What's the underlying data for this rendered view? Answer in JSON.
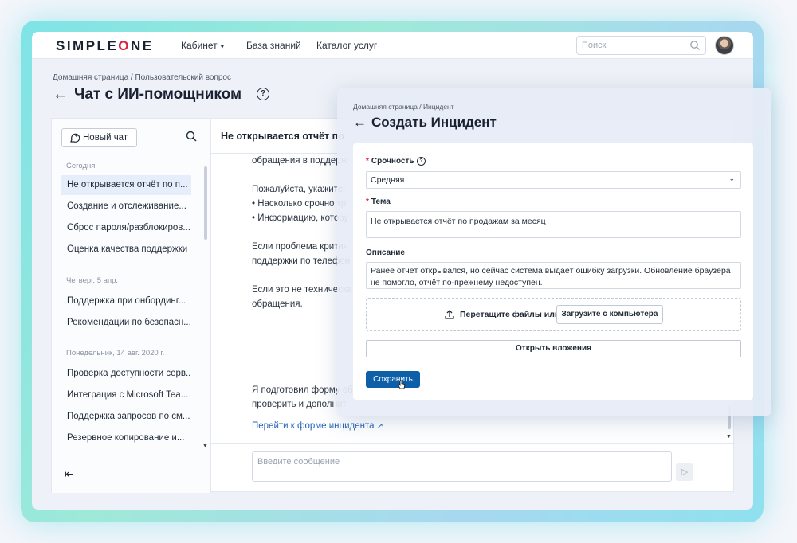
{
  "brand": {
    "logo_text": "SIMPLE",
    "logo_o": "O",
    "logo_end": "NE",
    "accent_color": "#d9233f"
  },
  "nav": {
    "items": [
      {
        "label": "Кабинет",
        "has_dropdown": true
      },
      {
        "label": "База знаний"
      },
      {
        "label": "Каталог услуг"
      }
    ],
    "search_placeholder": "Поиск"
  },
  "page": {
    "breadcrumb": "Домашняя страница  /  Пользовательский вопрос",
    "title": "Чат с ИИ-помощником"
  },
  "sidebar": {
    "new_chat_label": "Новый чат",
    "groups": [
      {
        "label": "Сегодня",
        "items": [
          "Не открывается отчёт по п...",
          "Создание и отслеживание...",
          "Сброс пароля/разблокиров...",
          "Оценка качества поддержки"
        ]
      },
      {
        "label": "Четверг, 5 апр.",
        "items": [
          "Поддержка при онбординг...",
          "Рекомендации по безопасн..."
        ]
      },
      {
        "label": "Понедельник, 14 авг. 2020 г.",
        "items": [
          "Проверка доступности серв...",
          "Интеграция с Microsoft Tea...",
          "Поддержка запросов по см...",
          "Резервное копирование и..."
        ]
      }
    ]
  },
  "chat": {
    "header_title": "Не открывается отчёт по",
    "messages": [
      "обращения в поддерж",
      "Пожалуйста, укажите:",
      "• Насколько срочно тр",
      "• Информацию, котору",
      "Если проблема критич",
      "поддержки по телефон",
      "Если это не техническа",
      "обращения.",
      "Я подготовил форму об",
      "проверить и дополнит"
    ],
    "link_text": "Перейти к форме инцидента",
    "composer_placeholder": "Введите сообщение"
  },
  "incident_form": {
    "breadcrumb": "Домашняя страница  /  Инцидент",
    "title": "Создать Инцидент",
    "urgency_label": "Срочность",
    "urgency_value": "Средняя",
    "topic_label": "Тема",
    "topic_value": "Не открывается отчёт по продажам за месяц",
    "description_label": "Описание",
    "description_value": "Ранее отчёт открывался, но сейчас система выдаёт ошибку загрузки. Обновление браузера не помогло, отчёт по-прежнему недоступен.",
    "dropzone_text": "Перетащите файлы или",
    "upload_button": "Загрузите с компьютера",
    "attachments_button": "Открыть вложения",
    "save_button": "Сохранить",
    "primary_color": "#0d5fa8"
  }
}
